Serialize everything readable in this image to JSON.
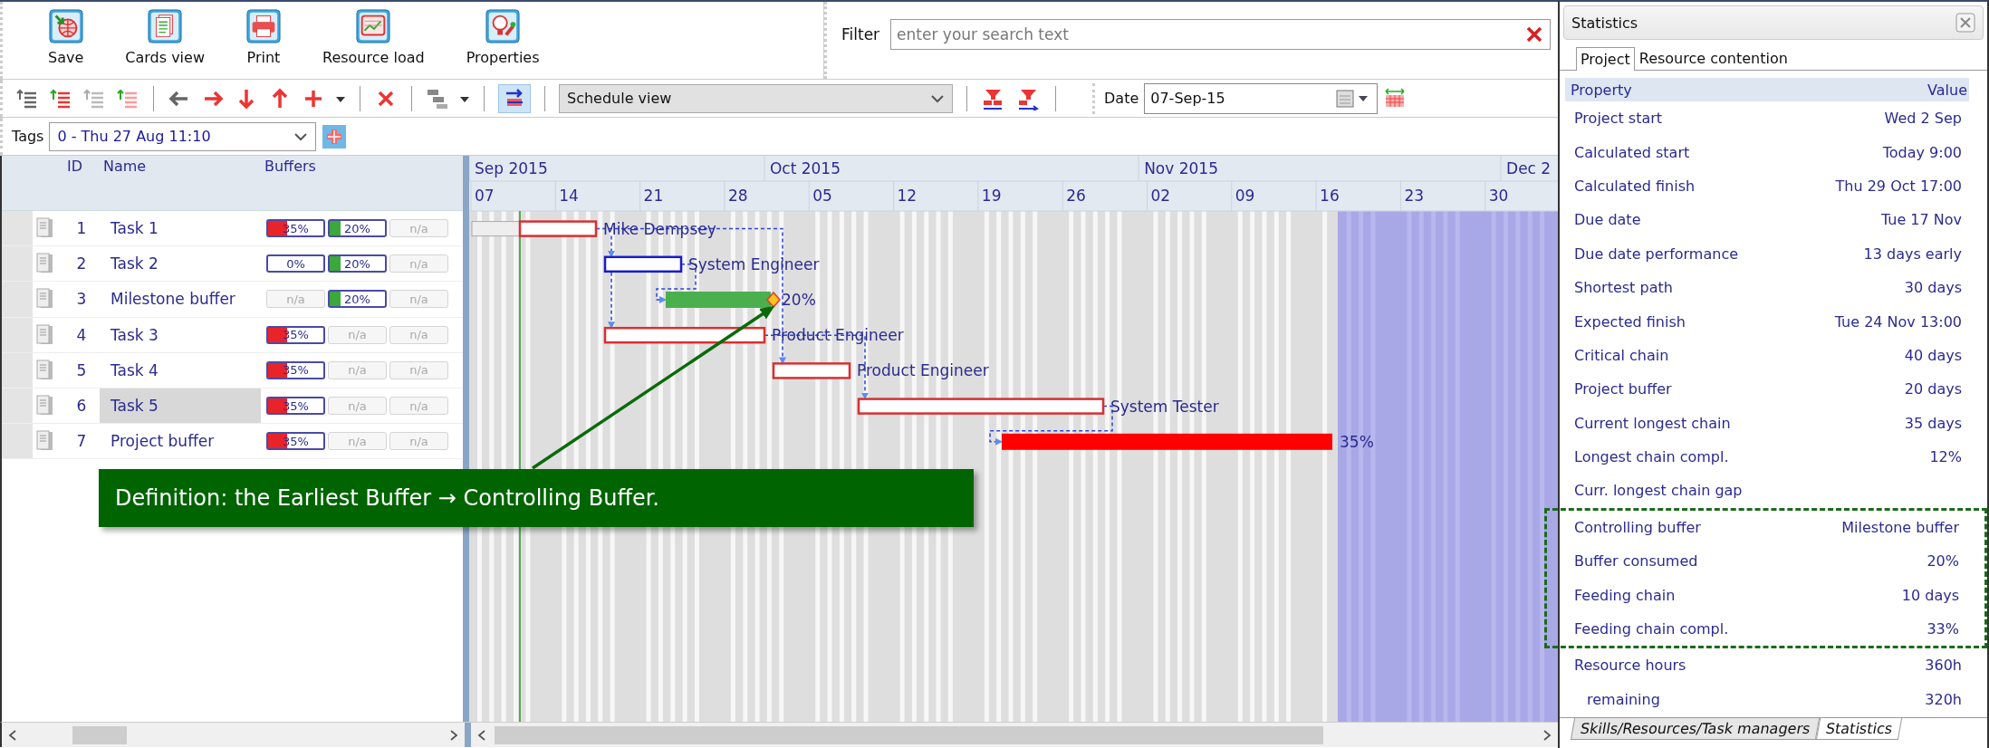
{
  "toolbar": {
    "buttons": [
      {
        "label": "Save",
        "kind": "save"
      },
      {
        "label": "Cards view",
        "kind": "cards"
      },
      {
        "label": "Print",
        "kind": "print"
      },
      {
        "label": "Resource load",
        "kind": "load"
      },
      {
        "label": "Properties",
        "kind": "properties"
      }
    ],
    "filter": {
      "label": "Filter",
      "placeholder": "enter your search text"
    }
  },
  "edit_toolbar": {
    "view": "Schedule view",
    "toggle_on": true,
    "date_label": "Date",
    "date": "07-Sep-15"
  },
  "tags": {
    "label": "Tags",
    "value": "0 - Thu 27 Aug 11:10"
  },
  "table": {
    "columns": [
      "ID",
      "Name",
      "Buffers"
    ],
    "rows": [
      {
        "id": "1",
        "name": "Task 1",
        "selected": false,
        "buffers": [
          {
            "kind": "meter",
            "text": "35%",
            "level": 0.35,
            "color": "#e8242a"
          },
          {
            "kind": "meter",
            "text": "20%",
            "level": 0.2,
            "color": "#3aa83a"
          },
          {
            "kind": "na",
            "text": "n/a"
          }
        ]
      },
      {
        "id": "2",
        "name": "Task 2",
        "selected": false,
        "buffers": [
          {
            "kind": "meter",
            "text": "0%"
          },
          {
            "kind": "meter",
            "text": "20%",
            "level": 0.2,
            "color": "#3aa83a"
          },
          {
            "kind": "na",
            "text": "n/a"
          }
        ]
      },
      {
        "id": "3",
        "name": "Milestone buffer",
        "selected": false,
        "buffers": [
          {
            "kind": "na",
            "text": "n/a"
          },
          {
            "kind": "meter",
            "text": "20%",
            "level": 0.2,
            "color": "#3aa83a"
          },
          {
            "kind": "na",
            "text": "n/a"
          }
        ]
      },
      {
        "id": "4",
        "name": "Task 3",
        "selected": false,
        "buffers": [
          {
            "kind": "meter",
            "text": "35%",
            "level": 0.35,
            "color": "#e8242a"
          },
          {
            "kind": "na",
            "text": "n/a"
          },
          {
            "kind": "na",
            "text": "n/a"
          }
        ]
      },
      {
        "id": "5",
        "name": "Task 4",
        "selected": false,
        "buffers": [
          {
            "kind": "meter",
            "text": "35%",
            "level": 0.35,
            "color": "#e8242a"
          },
          {
            "kind": "na",
            "text": "n/a"
          },
          {
            "kind": "na",
            "text": "n/a"
          }
        ]
      },
      {
        "id": "6",
        "name": "Task 5",
        "selected": true,
        "buffers": [
          {
            "kind": "meter",
            "text": "35%",
            "level": 0.35,
            "color": "#e8242a"
          },
          {
            "kind": "na",
            "text": "n/a"
          },
          {
            "kind": "na",
            "text": "n/a"
          }
        ]
      },
      {
        "id": "7",
        "name": "Project buffer",
        "selected": false,
        "buffers": [
          {
            "kind": "meter",
            "text": "35%",
            "level": 0.35,
            "color": "#e8242a"
          },
          {
            "kind": "na",
            "text": "n/a"
          },
          {
            "kind": "na",
            "text": "n/a"
          }
        ]
      }
    ]
  },
  "gantt": {
    "months": [
      "Sep 2015",
      "Oct 2015",
      "Nov 2015",
      "Dec 2"
    ],
    "weeks": [
      "07",
      "14",
      "21",
      "28",
      "05",
      "12",
      "19",
      "26",
      "02",
      "09",
      "16",
      "23",
      "30"
    ],
    "bars": [
      {
        "kind": "task",
        "label": "Mike Dempsey"
      },
      {
        "kind": "selected-task",
        "label": "System Engineer"
      },
      {
        "kind": "feeding-buffer",
        "label": "20%"
      },
      {
        "kind": "task",
        "label": "Product Engineer"
      },
      {
        "kind": "task",
        "label": "Product Engineer"
      },
      {
        "kind": "task",
        "label": "System Tester"
      },
      {
        "kind": "project-buffer",
        "label": "35%"
      }
    ]
  },
  "callout": {
    "text": "Definition: the Earliest Buffer → Controlling Buffer."
  },
  "statistics": {
    "title": "Statistics",
    "tabs": [
      {
        "label": "Project",
        "selected": true
      },
      {
        "label": "Resource contention",
        "selected": false
      }
    ],
    "columns": [
      "Property",
      "Value"
    ],
    "rows": [
      {
        "property": "Project start",
        "value": "Wed 2 Sep",
        "highlighted": false
      },
      {
        "property": "Calculated start",
        "value": "Today 9:00",
        "highlighted": false
      },
      {
        "property": "Calculated finish",
        "value": "Thu 29 Oct 17:00",
        "highlighted": false
      },
      {
        "property": "Due date",
        "value": "Tue 17 Nov",
        "highlighted": false
      },
      {
        "property": "Due date performance",
        "value": "13 days early",
        "highlighted": false
      },
      {
        "property": "Shortest path",
        "value": "30 days",
        "highlighted": false
      },
      {
        "property": "Expected finish",
        "value": "Tue 24 Nov 13:00",
        "highlighted": false
      },
      {
        "property": "Critical chain",
        "value": "40 days",
        "highlighted": false
      },
      {
        "property": "Project buffer",
        "value": "20 days",
        "highlighted": false
      },
      {
        "property": "Current longest chain",
        "value": "35 days",
        "highlighted": false
      },
      {
        "property": "Longest chain compl.",
        "value": "12%",
        "highlighted": false
      },
      {
        "property": "Curr. longest chain gap",
        "highlighted": false
      },
      {
        "property": "Controlling buffer",
        "value": "Milestone buffer",
        "highlighted": true
      },
      {
        "property": "Buffer consumed",
        "value": "20%",
        "highlighted": true
      },
      {
        "property": "Feeding chain",
        "value": "10 days",
        "highlighted": true
      },
      {
        "property": "Feeding chain compl.",
        "value": "33%",
        "highlighted": true
      },
      {
        "property": "Resource hours",
        "value": "360h",
        "highlighted": false,
        "children": [
          {
            "property": "remaining",
            "value": "320h"
          }
        ]
      }
    ],
    "bottom_tabs": [
      {
        "label": "Skills/Resources/Task managers",
        "selected": false
      },
      {
        "label": "Statistics",
        "selected": true
      }
    ]
  }
}
